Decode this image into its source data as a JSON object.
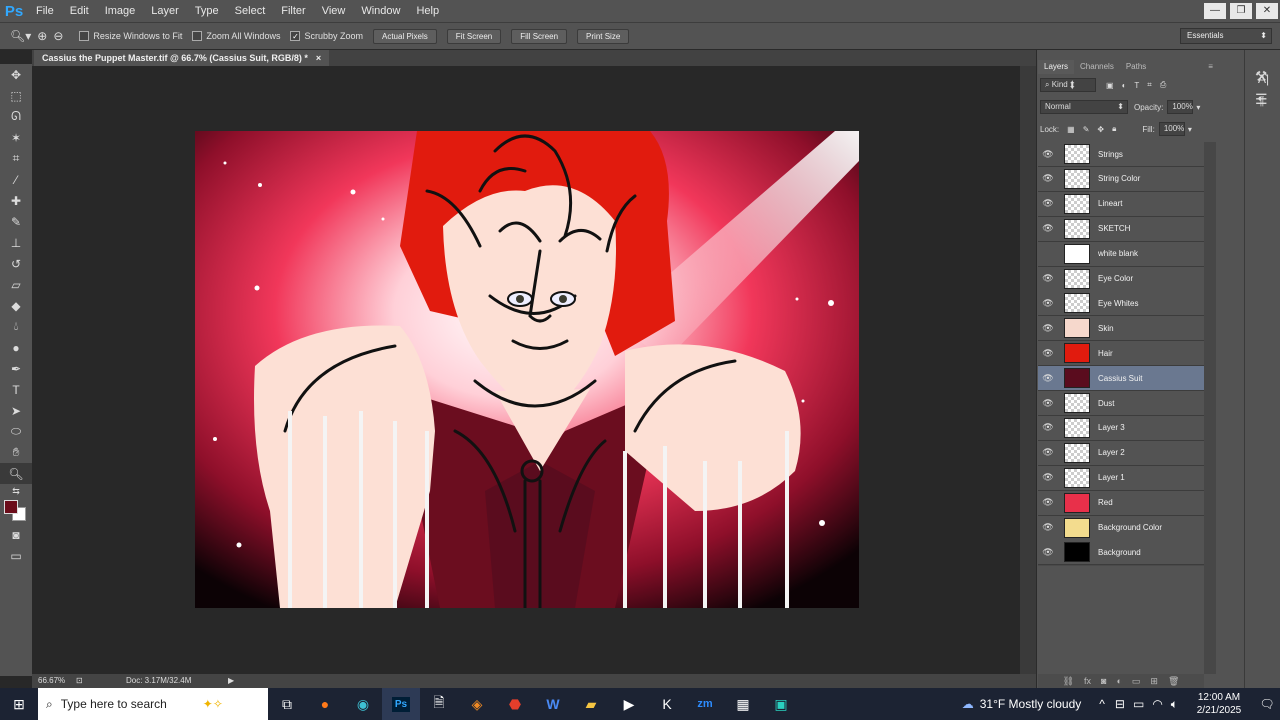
{
  "app": {
    "logo": "Ps"
  },
  "menu": [
    "File",
    "Edit",
    "Image",
    "Layer",
    "Type",
    "Select",
    "Filter",
    "View",
    "Window",
    "Help"
  ],
  "window_controls": [
    "—",
    "❐",
    "✕"
  ],
  "options": {
    "tool_icons": [
      "magnifier-icon",
      "zoom-in-icon",
      "zoom-out-icon"
    ],
    "resize_windows": "Resize Windows to Fit",
    "zoom_all": "Zoom All Windows",
    "scrubby": "Scrubby Zoom",
    "actual_pixels": "Actual Pixels",
    "fit_screen": "Fit Screen",
    "fill_screen": "Fill Screen",
    "print_size": "Print Size",
    "workspace": "Essentials"
  },
  "document": {
    "tab_title": "Cassius the Puppet Master.tif @ 66.7% (Cassius Suit, RGB/8) *",
    "zoom": "66.67%",
    "doc_size": "Doc: 3.17M/32.4M"
  },
  "panels": {
    "tabs": [
      "Layers",
      "Channels",
      "Paths"
    ],
    "kind": "Kind",
    "blend_mode": "Normal",
    "opacity_label": "Opacity:",
    "opacity": "100%",
    "lock_label": "Lock:",
    "fill_label": "Fill:",
    "fill": "100%"
  },
  "layers": [
    {
      "name": "Strings",
      "thumb": "transparent",
      "visible": true
    },
    {
      "name": "String Color",
      "thumb": "transparent",
      "visible": true
    },
    {
      "name": "Lineart",
      "thumb": "transparent",
      "visible": true
    },
    {
      "name": "SKETCH",
      "thumb": "transparent",
      "visible": true
    },
    {
      "name": "white blank",
      "thumb": "#ffffff",
      "visible": false
    },
    {
      "name": "Eye Color",
      "thumb": "transparent",
      "visible": true
    },
    {
      "name": "Eye Whites",
      "thumb": "transparent",
      "visible": true
    },
    {
      "name": "Skin",
      "thumb": "#f6d8cc",
      "visible": true
    },
    {
      "name": "Hair",
      "thumb": "#e11b0e",
      "visible": true
    },
    {
      "name": "Cassius Suit",
      "thumb": "#5a0c1e",
      "visible": true,
      "selected": true
    },
    {
      "name": "Dust",
      "thumb": "transparent",
      "visible": true
    },
    {
      "name": "Layer 3",
      "thumb": "transparent",
      "visible": true
    },
    {
      "name": "Layer 2",
      "thumb": "transparent",
      "visible": true
    },
    {
      "name": "Layer 1",
      "thumb": "transparent",
      "visible": true
    },
    {
      "name": "Red",
      "thumb": "#e8304a",
      "visible": true
    },
    {
      "name": "Background Color",
      "thumb": "#f3dc8e",
      "visible": true
    },
    {
      "name": "Background",
      "thumb": "#000000",
      "visible": true
    }
  ],
  "colors": {
    "accent_ps": "#31a8ff",
    "foreground": "#6b0d1a",
    "hair": "#e11b0e",
    "skin": "#fde0d5",
    "suit": "#5a0c1e"
  },
  "taskbar": {
    "search_placeholder": "Type here to search",
    "weather": "31°F  Mostly cloudy",
    "time": "12:00 AM",
    "date": "2/21/2025"
  }
}
